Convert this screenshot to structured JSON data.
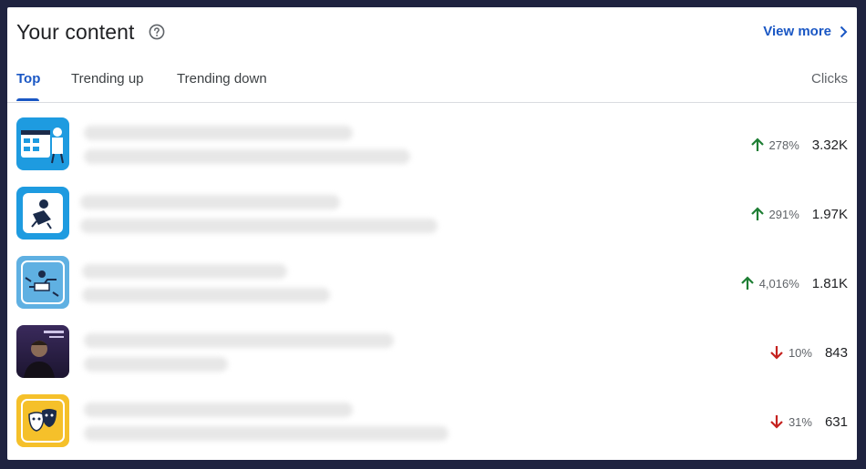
{
  "header": {
    "title": "Your content",
    "view_more_label": "View more"
  },
  "tabs": [
    {
      "label": "Top",
      "active": true
    },
    {
      "label": "Trending up",
      "active": false
    },
    {
      "label": "Trending down",
      "active": false
    }
  ],
  "metric_label": "Clicks",
  "rows": [
    {
      "thumb_icon": "web-browser-illustration-thumbnail",
      "trend": "up",
      "change": "278%",
      "clicks": "3.32K"
    },
    {
      "thumb_icon": "person-reading-illustration-thumbnail",
      "trend": "up",
      "change": "291%",
      "clicks": "1.97K"
    },
    {
      "thumb_icon": "workflow-diagram-illustration-thumbnail",
      "trend": "up",
      "change": "4,016%",
      "clicks": "1.81K"
    },
    {
      "thumb_icon": "portrait-photo-thumbnail",
      "trend": "down",
      "change": "10%",
      "clicks": "843"
    },
    {
      "thumb_icon": "theater-masks-thumbnail",
      "trend": "down",
      "change": "31%",
      "clicks": "631"
    }
  ],
  "colors": {
    "accent": "#1a57c4",
    "trend_up": "#1e7e34",
    "trend_down": "#c5221f"
  }
}
